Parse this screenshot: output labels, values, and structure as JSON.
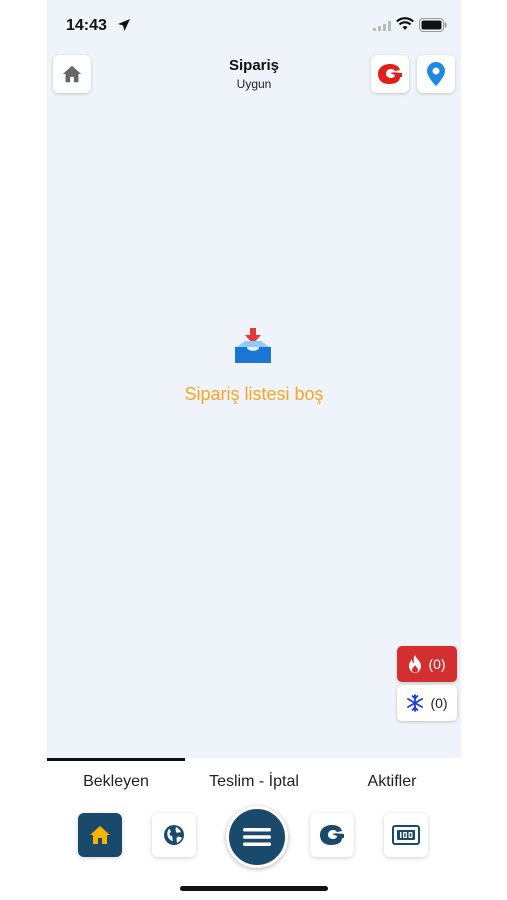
{
  "status_bar": {
    "time": "14:43"
  },
  "header": {
    "title": "Sipariş",
    "subtitle": "Uygun"
  },
  "empty_state": {
    "message": "Sipariş listesi boş"
  },
  "counters": {
    "hot": "(0)",
    "cold": "(0)"
  },
  "tabs": [
    {
      "label": "Bekleyen",
      "active": true
    },
    {
      "label": "Teslim - İptal",
      "active": false
    },
    {
      "label": "Aktifler",
      "active": false
    }
  ],
  "colors": {
    "accent": "#1a4a6b",
    "empty_text": "#f5a623",
    "hot": "#d32f2f",
    "brand_red": "#e0201b",
    "pin_blue": "#1e88e5"
  },
  "icons": {
    "header": [
      "home-icon",
      "brand-logo-icon",
      "location-pin-icon"
    ],
    "bottom_nav": [
      "home-icon",
      "globe-icon",
      "menu-icon",
      "brand-logo-icon",
      "counter-display-icon"
    ]
  }
}
